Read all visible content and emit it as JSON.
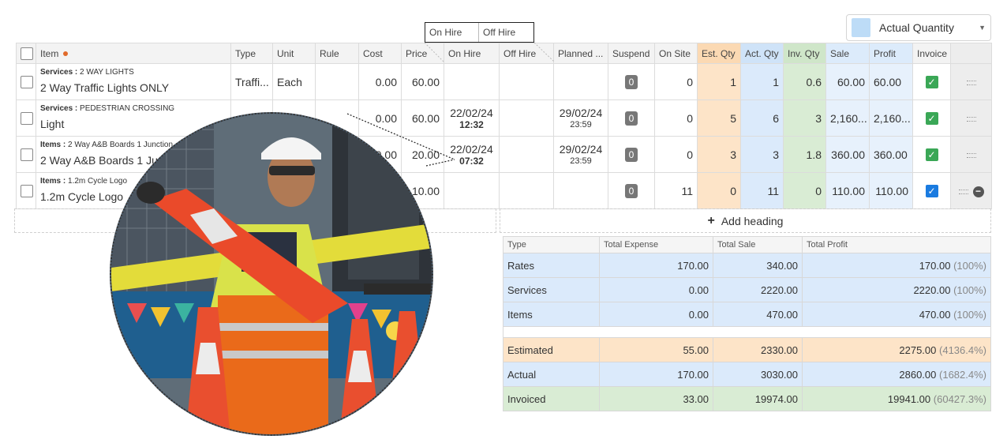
{
  "hire_tooltip": {
    "on_hire": "On Hire",
    "off_hire": "Off Hire"
  },
  "quantity_select": {
    "value": "Actual Quantity",
    "swatch_color": "#bddcf7"
  },
  "columns": {
    "item": "Item",
    "type": "Type",
    "unit": "Unit",
    "rule": "Rule",
    "cost": "Cost",
    "price": "Price",
    "on_hire": "On Hire",
    "off_hire": "Off Hire",
    "planned": "Planned ...",
    "suspend": "Suspend",
    "on_site": "On Site",
    "est_qty": "Est. Qty",
    "act_qty": "Act. Qty",
    "inv_qty": "Inv. Qty",
    "sale": "Sale",
    "profit": "Profit",
    "invoice": "Invoice"
  },
  "rows": [
    {
      "category": "Services :",
      "category_detail": "2 WAY LIGHTS",
      "name": "2 Way Traffic Lights ONLY",
      "type": "Traffi...",
      "unit": "Each",
      "rule": "",
      "cost": "0.00",
      "price": "60.00",
      "on_hire_date": "",
      "on_hire_time": "",
      "off_hire": "",
      "planned_date": "",
      "planned_time": "",
      "suspend": "0",
      "on_site": "0",
      "est_qty": "1",
      "act_qty": "1",
      "inv_qty": "0.6",
      "sale": "60.00",
      "profit": "60.00",
      "invoice_check": "✓"
    },
    {
      "category": "Services :",
      "category_detail": "PEDESTRIAN CROSSING",
      "name": "Light",
      "type": "",
      "unit": "",
      "rule": "",
      "cost": "0.00",
      "price": "60.00",
      "on_hire_date": "22/02/24",
      "on_hire_time": "12:32",
      "off_hire": "",
      "planned_date": "29/02/24",
      "planned_time": "23:59",
      "suspend": "0",
      "on_site": "0",
      "est_qty": "5",
      "act_qty": "6",
      "inv_qty": "3",
      "sale": "2,160...",
      "profit": "2,160...",
      "invoice_check": "✓"
    },
    {
      "category": "Items :",
      "category_detail": "2 Way A&B Boards 1 Junction",
      "name": "2 Way A&B Boards 1 Junction",
      "type": "",
      "unit": "",
      "rule": "",
      "cost": "0.00",
      "price": "20.00",
      "on_hire_date": "22/02/24",
      "on_hire_time": "07:32",
      "off_hire": "",
      "planned_date": "29/02/24",
      "planned_time": "23:59",
      "suspend": "0",
      "on_site": "0",
      "est_qty": "3",
      "act_qty": "3",
      "inv_qty": "1.8",
      "sale": "360.00",
      "profit": "360.00",
      "invoice_check": "✓"
    },
    {
      "category": "Items :",
      "category_detail": "1.2m Cycle Logo",
      "name": "1.2m Cycle Logo",
      "type": "",
      "unit": "",
      "rule": "",
      "cost": "",
      "price": "10.00",
      "on_hire_date": "",
      "on_hire_time": "",
      "off_hire": "",
      "planned_date": "",
      "planned_time": "",
      "suspend": "0",
      "on_site": "11",
      "est_qty": "0",
      "act_qty": "11",
      "inv_qty": "0",
      "sale": "110.00",
      "profit": "110.00",
      "invoice_check": "✓"
    }
  ],
  "add_heading": {
    "plus": "+",
    "label": "Add heading"
  },
  "summary": {
    "headers": {
      "type": "Type",
      "expense": "Total Expense",
      "sale": "Total Sale",
      "profit": "Total Profit"
    },
    "rows": [
      {
        "type": "Rates",
        "expense": "170.00",
        "sale": "340.00",
        "profit": "170.00",
        "pct": "(100%)"
      },
      {
        "type": "Services",
        "expense": "0.00",
        "sale": "2220.00",
        "profit": "2220.00",
        "pct": "(100%)"
      },
      {
        "type": "Items",
        "expense": "0.00",
        "sale": "470.00",
        "profit": "470.00",
        "pct": "(100%)"
      },
      {
        "type": "Estimated",
        "expense": "55.00",
        "sale": "2330.00",
        "profit": "2275.00",
        "pct": "(4136.4%)"
      },
      {
        "type": "Actual",
        "expense": "170.00",
        "sale": "3030.00",
        "profit": "2860.00",
        "pct": "(1682.4%)"
      },
      {
        "type": "Invoiced",
        "expense": "33.00",
        "sale": "19974.00",
        "profit": "19941.00",
        "pct": "(60427.3%)"
      }
    ]
  },
  "colors": {
    "estimated": "#fde4c8",
    "actual": "#dbeafb",
    "invoiced": "#d9ecd4",
    "check_green": "#3aa756",
    "check_blue": "#1a7be0"
  }
}
